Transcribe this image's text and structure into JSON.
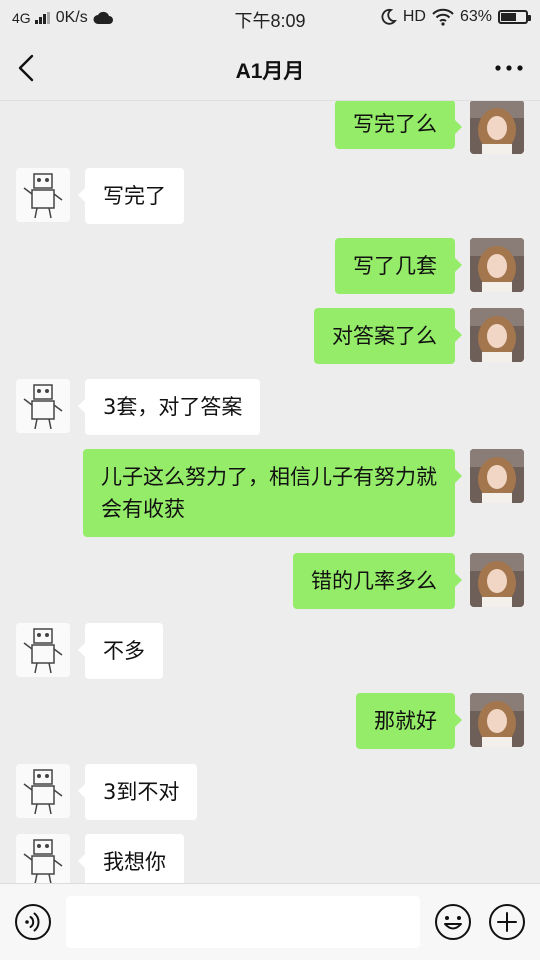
{
  "status_bar": {
    "network": "4G",
    "speed": "0K/s",
    "time": "下午8:09",
    "hd": "HD",
    "battery_percent_text": "63%",
    "battery_level": 0.63
  },
  "header": {
    "title": "A1月月"
  },
  "messages": [
    {
      "side": "right",
      "text": "写完了么"
    },
    {
      "side": "left",
      "text": "写完了"
    },
    {
      "side": "right",
      "text": "写了几套"
    },
    {
      "side": "right",
      "text": "对答案了么"
    },
    {
      "side": "left",
      "text": "3套，对了答案"
    },
    {
      "side": "right",
      "text": "儿子这么努力了，相信儿子有努力就会有收获"
    },
    {
      "side": "right",
      "text": "错的几率多么"
    },
    {
      "side": "left",
      "text": "不多"
    },
    {
      "side": "right",
      "text": "那就好"
    },
    {
      "side": "left",
      "text": "3到不对"
    },
    {
      "side": "left",
      "text": "我想你"
    }
  ],
  "input": {
    "value": "",
    "placeholder": ""
  },
  "icons": {
    "back": "chevron-left-icon",
    "more": "more-dots-icon",
    "voice": "voice-icon",
    "emoji": "emoji-icon",
    "plus": "plus-icon"
  },
  "colors": {
    "sent_bubble": "#95ec69",
    "received_bubble": "#ffffff",
    "background": "#ededed"
  }
}
